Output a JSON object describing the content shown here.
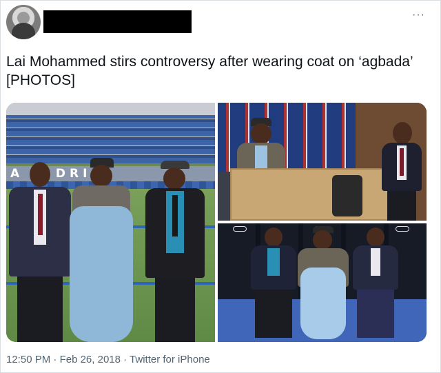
{
  "header": {
    "more_label": "···",
    "avatar_icon": "profile-avatar",
    "name_redacted": true
  },
  "tweet": {
    "text": "Lai Mohammed stirs controversy after wearing coat on ‘agbada’ [PHOTOS]"
  },
  "stadium_banner": "A M DRI",
  "meta": {
    "time": "12:50 PM",
    "separator": "·",
    "date": "Feb 26, 2018",
    "source": "Twitter for iPhone"
  },
  "colors": {
    "text_primary": "#0f1419",
    "text_secondary": "#536471",
    "border": "#d9dee2"
  }
}
